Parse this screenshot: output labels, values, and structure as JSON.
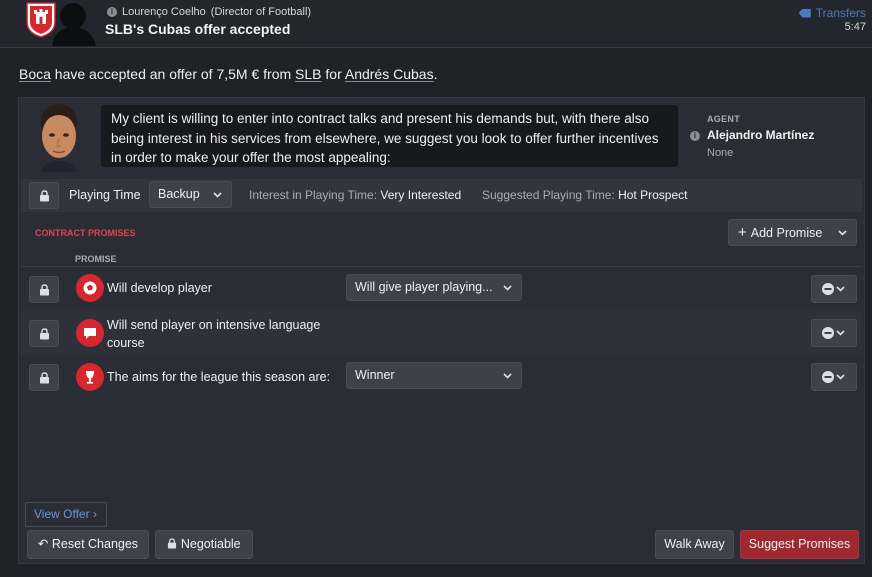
{
  "header": {
    "sender": "Lourenço Coelho",
    "sender_role": "(Director of Football)",
    "subject": "SLB's Cubas offer accepted",
    "category": "Transfers",
    "time": "5:47"
  },
  "headline": {
    "club_from": "Boca",
    "text1": " have accepted an offer of 7,5M € from ",
    "club_to": "SLB",
    "text2": " for ",
    "player": "Andrés Cubas",
    "end": "."
  },
  "message": "My client is willing to enter into contract talks and present his demands but, with there also being interest in his services from elsewhere, we suggest you look to offer further incentives in order to make your offer the most appealing:",
  "agent": {
    "label": "AGENT",
    "name": "Alejandro Martínez",
    "sub": "None"
  },
  "playing_time": {
    "label": "Playing Time",
    "value": "Backup",
    "interest_label": "Interest in Playing Time:",
    "interest_value": "Very Interested",
    "suggested_label": "Suggested Playing Time:",
    "suggested_value": "Hot Prospect"
  },
  "promises": {
    "section_title": "CONTRACT PROMISES",
    "add_label": "Add Promise",
    "column_header": "PROMISE",
    "rows": [
      {
        "text": "Will develop player",
        "icon": "football-icon",
        "select": "Will give player playing..."
      },
      {
        "text": "Will send player on intensive language course",
        "icon": "speech-bubble-icon",
        "select": ""
      },
      {
        "text": "The aims for the league this season are:",
        "icon": "trophy-icon",
        "select": "Winner"
      }
    ]
  },
  "footer": {
    "view_offer": "View Offer",
    "reset": "Reset Changes",
    "negotiable": "Negotiable",
    "walk_away": "Walk Away",
    "suggest": "Suggest Promises"
  },
  "colors": {
    "accent_red": "#d6262e",
    "primary_button": "#9e2830",
    "link_blue": "#6b98d6"
  }
}
